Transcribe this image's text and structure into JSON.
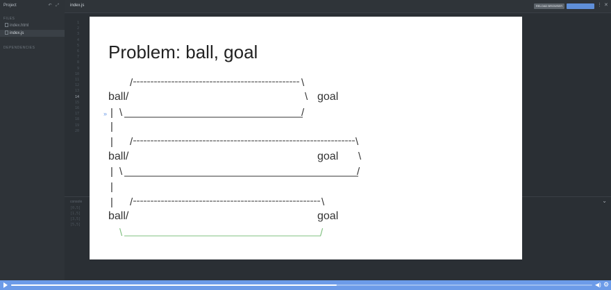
{
  "sidebar": {
    "header": "Project",
    "header_icons": "↶ ⤢",
    "files_section": "FILES",
    "files": [
      {
        "name": "index.html",
        "active": false
      },
      {
        "name": "index.js",
        "active": true
      }
    ],
    "deps_section": "DEPENDENCIES"
  },
  "tabbar": {
    "tab": "index.js",
    "reload_button": "RELOAD BROWSER",
    "blue_button": "",
    "menu": "⋮",
    "close": "✕"
  },
  "line_numbers": [
    "1",
    "2",
    "3",
    "4",
    "5",
    "6",
    "7",
    "8",
    "9",
    "10",
    "11",
    "12",
    "13",
    "14",
    "15",
    "16",
    "17",
    "18",
    "19",
    "20"
  ],
  "highlighted_line": "14",
  "console": {
    "label": "console",
    "chevron": "⌄",
    "lines": [
      "[0,5]",
      "[1,5]",
      "[3,5]",
      "[5,5]"
    ]
  },
  "slide": {
    "title": "Problem: ball, goal",
    "ball_label": "ball/",
    "goal_label": "goal",
    "pipe": "|",
    "backslash": "\\",
    "slash": "/",
    "marker": "»"
  },
  "player": {
    "progress": 0.56,
    "volume_icon": "◀)",
    "settings_icon": "⚙"
  },
  "colors": {
    "diagram_text": "#333333",
    "green_path": "#7fbf7f",
    "blue_accent": "#6c9be8"
  }
}
